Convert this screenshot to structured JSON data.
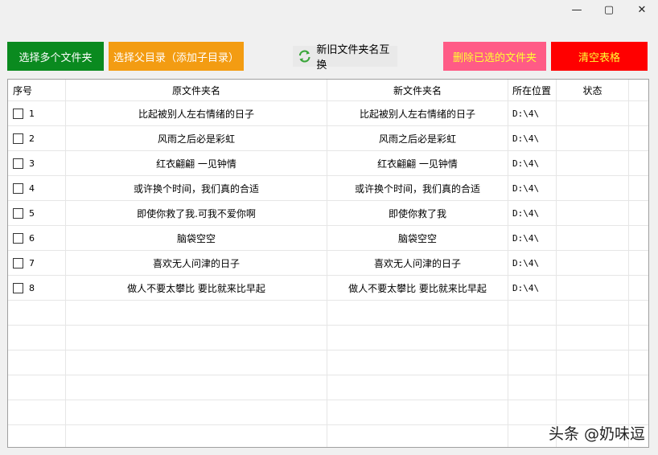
{
  "window": {
    "minimize": "—",
    "maximize": "▢",
    "close": "✕"
  },
  "toolbar": {
    "select_multiple": "选择多个文件夹",
    "select_parent": "选择父目录（添加子目录）",
    "swap_names": "新旧文件夹名互换",
    "delete_selected": "删除已选的文件夹",
    "clear_table": "清空表格"
  },
  "colors": {
    "green": "#0a8a1f",
    "orange": "#f39c12",
    "pink": "#ff5b86",
    "red": "#ff0000",
    "yellow_text": "#ffff33"
  },
  "table": {
    "headers": [
      "序号",
      "原文件夹名",
      "新文件夹名",
      "所在位置",
      "状态"
    ],
    "rows": [
      {
        "index": "1",
        "original": "比起被别人左右情绪的日子",
        "new": "比起被别人左右情绪的日子",
        "location": "D:\\4\\",
        "status": ""
      },
      {
        "index": "2",
        "original": "风雨之后必是彩虹",
        "new": "风雨之后必是彩虹",
        "location": "D:\\4\\",
        "status": ""
      },
      {
        "index": "3",
        "original": "红衣翩翩 一见钟情",
        "new": "红衣翩翩 一见钟情",
        "location": "D:\\4\\",
        "status": ""
      },
      {
        "index": "4",
        "original": "或许换个时间，我们真的合适",
        "new": "或许换个时间，我们真的合适",
        "location": "D:\\4\\",
        "status": ""
      },
      {
        "index": "5",
        "original": "即使你救了我.可我不爱你啊",
        "new": "即使你救了我",
        "location": "D:\\4\\",
        "status": ""
      },
      {
        "index": "6",
        "original": "脑袋空空",
        "new": "脑袋空空",
        "location": "D:\\4\\",
        "status": ""
      },
      {
        "index": "7",
        "original": "喜欢无人问津的日子",
        "new": "喜欢无人问津的日子",
        "location": "D:\\4\\",
        "status": ""
      },
      {
        "index": "8",
        "original": "做人不要太攀比 要比就来比早起",
        "new": "做人不要太攀比 要比就来比早起",
        "location": "D:\\4\\",
        "status": ""
      }
    ]
  },
  "watermark": "头条 @奶味逗"
}
